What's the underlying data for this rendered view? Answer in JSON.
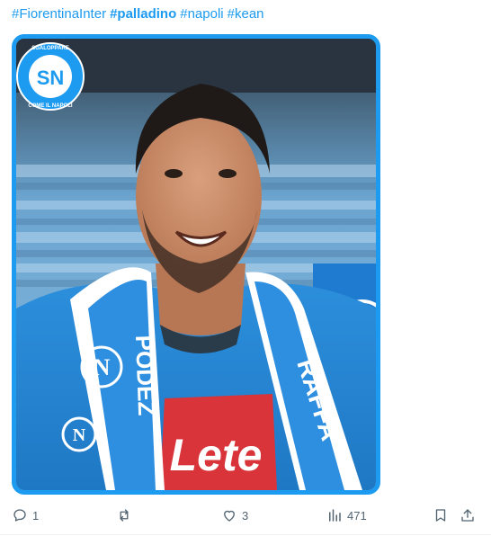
{
  "post": {
    "hashtags": [
      {
        "text": "#FiorentinaInter",
        "bold": false
      },
      {
        "text": "#palladino",
        "bold": true
      },
      {
        "text": "#napoli",
        "bold": false
      },
      {
        "text": "#kean",
        "bold": false
      }
    ],
    "media": {
      "logo_text": "SN",
      "logo_ring_top": "SGALOPPARE",
      "logo_ring_bottom": "COME IL NAPOLI",
      "scarf_text_left": "PODEZ",
      "scarf_text_right": "RAFFA",
      "shirt_sponsor": "Lete"
    }
  },
  "actions": {
    "reply_count": "1",
    "repost_count": "",
    "like_count": "3",
    "views_count": "471"
  },
  "colors": {
    "accent": "#1d9bf0",
    "icon_gray": "#536471"
  }
}
